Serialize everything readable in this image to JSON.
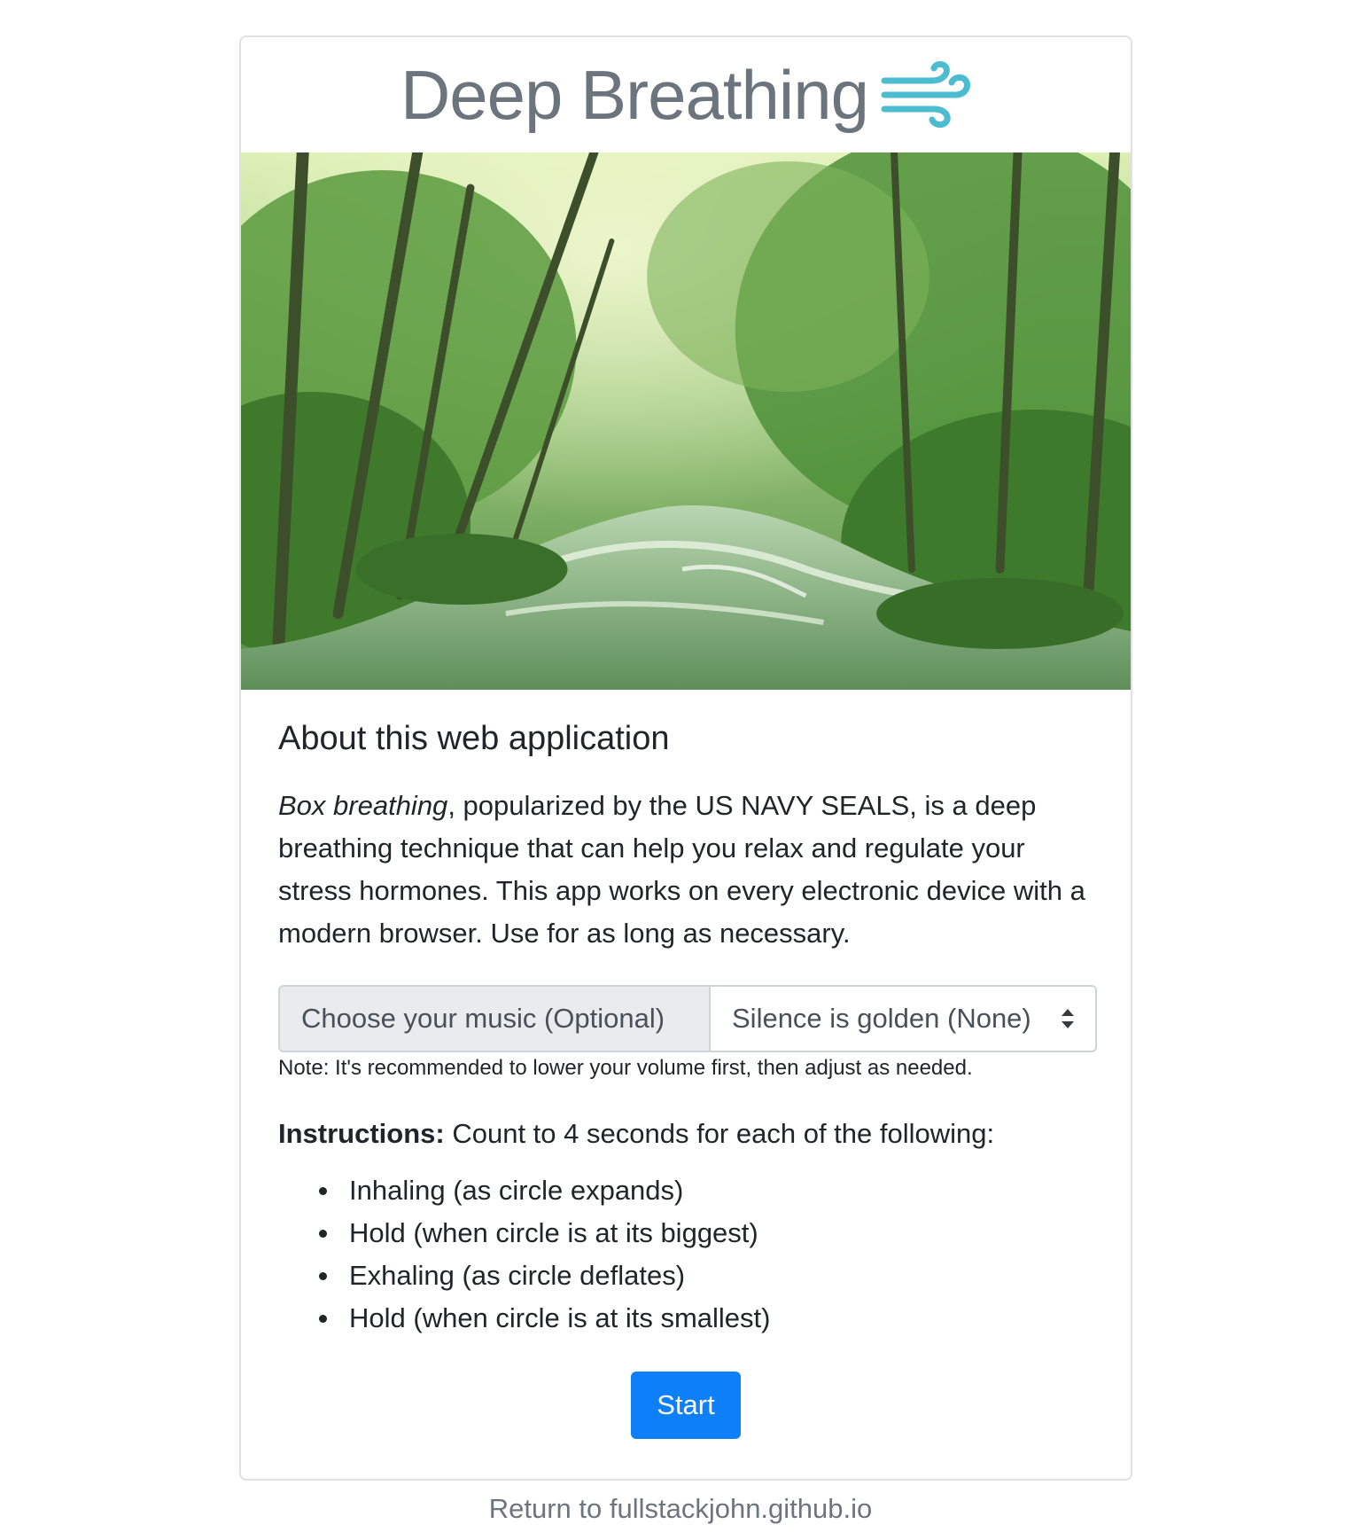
{
  "header": {
    "title": "Deep Breathing",
    "icon": "wind-icon",
    "icon_color": "#4cbcd1"
  },
  "hero": {
    "icon": "forest-stream-image"
  },
  "about": {
    "heading": "About this web application",
    "intro_italic": "Box breathing",
    "intro_text": ", popularized by the US NAVY SEALS, is a deep breathing technique that can help you relax and regulate your stress hormones. This app works on every electronic device with a modern browser. Use for as long as necessary."
  },
  "music": {
    "label": "Choose your music (Optional)",
    "selected": "Silence is golden (None)",
    "note": "Note: It's recommended to lower your volume first, then adjust as needed."
  },
  "instructions": {
    "label": "Instructions:",
    "text": " Count to 4 seconds for each of the following:",
    "steps": [
      "Inhaling (as circle expands)",
      "Hold (when circle is at its biggest)",
      "Exhaling (as circle deflates)",
      "Hold (when circle is at its smallest)"
    ]
  },
  "start_button": {
    "label": "Start",
    "color": "#0d7ff8"
  },
  "footer": {
    "link_text": "Return to fullstackjohn.github.io"
  }
}
